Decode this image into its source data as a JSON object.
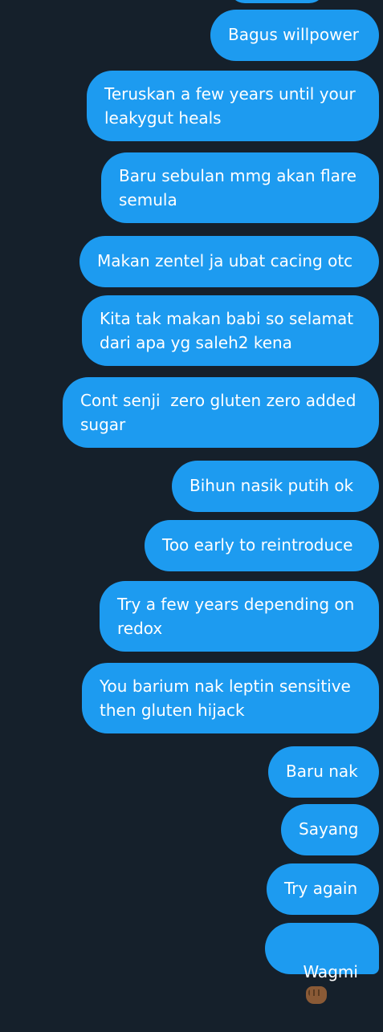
{
  "messages": [
    {
      "text": "Bagus willpower"
    },
    {
      "text": "Teruskan a few years until your\nleakygut heals"
    },
    {
      "text": "Baru sebulan mmg akan flare\nsemula"
    },
    {
      "text": "Makan zentel ja ubat cacing otc"
    },
    {
      "text": "Kita tak makan babi so selamat\ndari apa yg saleh2 kena"
    },
    {
      "text": "Cont senji  zero gluten zero added\nsugar"
    },
    {
      "text": "Bihun nasik putih ok"
    },
    {
      "text": "Too early to reintroduce"
    },
    {
      "text": "Try a few years depending on\nredox"
    },
    {
      "text": "You barium nak leptin sensitive\nthen gluten hijack"
    },
    {
      "text": "Baru nak"
    },
    {
      "text": "Sayang"
    },
    {
      "text": "Try again"
    },
    {
      "text": "Wagmi",
      "emoji": "fist-emoji"
    }
  ],
  "colors": {
    "background": "#15202b",
    "bubble": "#1d9bf0",
    "text": "#ffffff"
  }
}
